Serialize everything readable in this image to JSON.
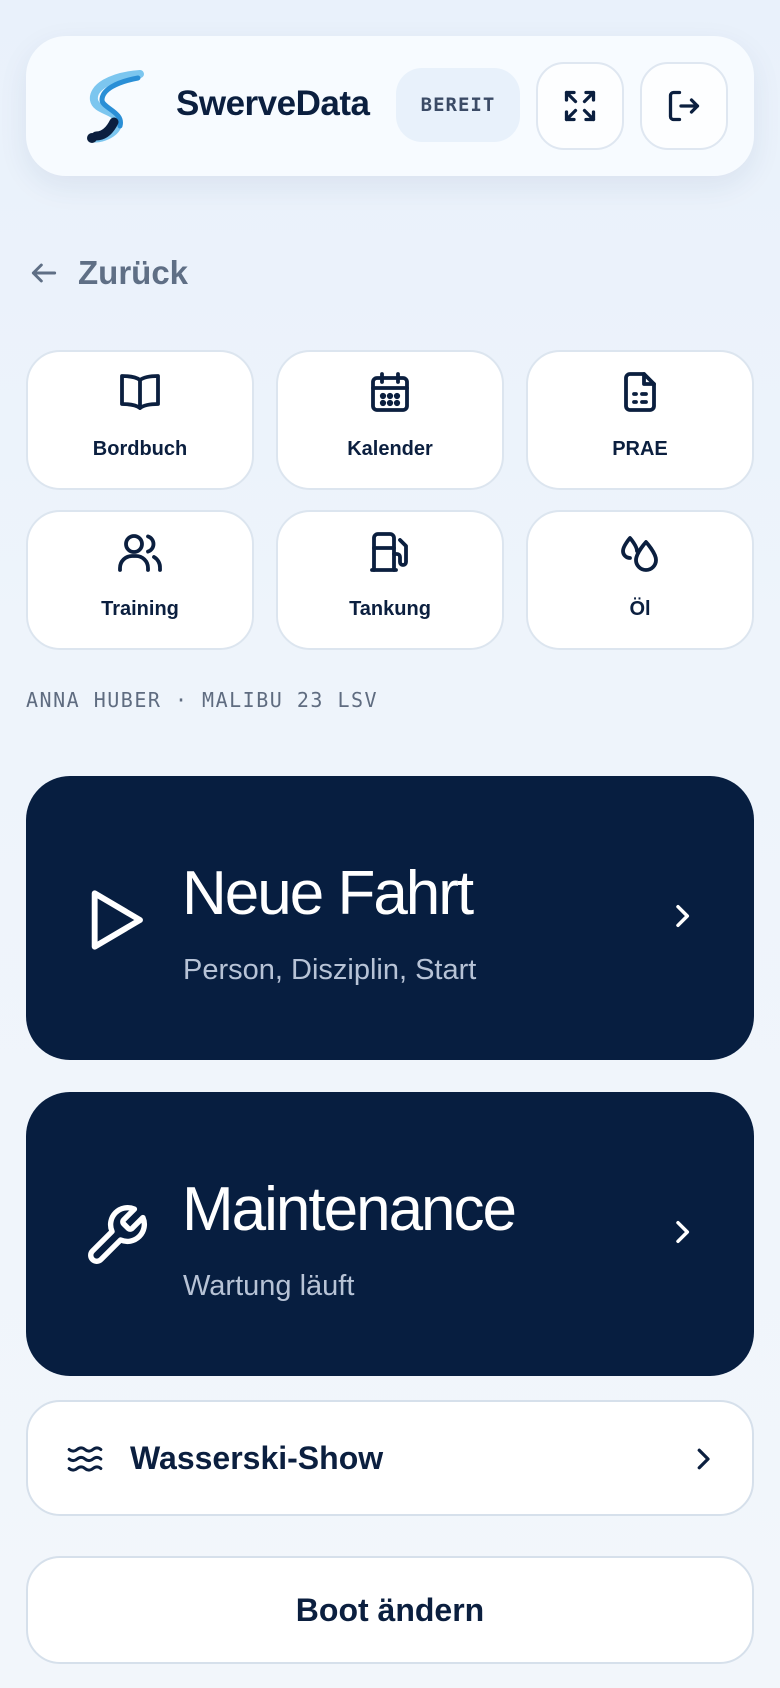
{
  "header": {
    "brand": "SwerveData",
    "status": "BEREIT",
    "fullscreen_icon": "expand-icon",
    "logout_icon": "logout-icon"
  },
  "nav": {
    "back_label": "Zurück"
  },
  "tiles": [
    {
      "label": "Bordbuch",
      "icon": "book-icon"
    },
    {
      "label": "Kalender",
      "icon": "calendar-icon"
    },
    {
      "label": "PRAE",
      "icon": "document-icon"
    },
    {
      "label": "Training",
      "icon": "users-icon"
    },
    {
      "label": "Tankung",
      "icon": "fuel-icon"
    },
    {
      "label": "Öl",
      "icon": "droplets-icon"
    }
  ],
  "context": {
    "line": "ANNA HUBER · MALIBU 23 LSV"
  },
  "actions": {
    "new_ride": {
      "title": "Neue Fahrt",
      "subtitle": "Person, Disziplin, Start"
    },
    "maintenance": {
      "title": "Maintenance",
      "subtitle": "Wartung läuft"
    }
  },
  "show": {
    "label": "Wasserski-Show"
  },
  "change_boat": {
    "label": "Boot ändern"
  },
  "colors": {
    "navy": "#071e40",
    "text": "#0b1f3f",
    "muted": "#5f6f85",
    "accent_blue": "#3aa8e8"
  }
}
